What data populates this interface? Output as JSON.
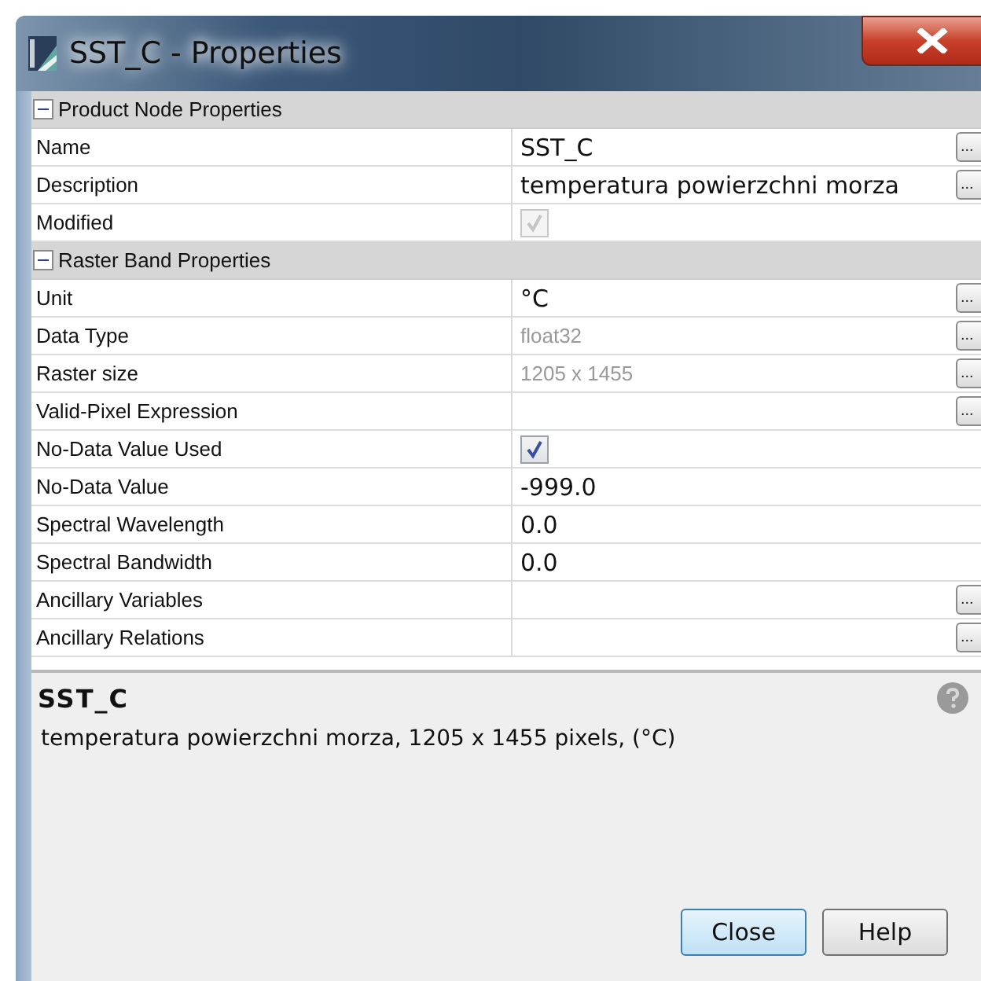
{
  "window": {
    "title": "SST_C - Properties"
  },
  "sections": [
    {
      "title": "Product Node Properties",
      "expanded": true,
      "rows": [
        {
          "label": "Name",
          "kind": "text",
          "value": "SST_C",
          "editable": true,
          "editor_button": "..."
        },
        {
          "label": "Description",
          "kind": "text",
          "value": "temperatura powierzchni morza",
          "editable": true,
          "editor_button": "..."
        },
        {
          "label": "Modified",
          "kind": "checkbox",
          "checked": true,
          "disabled": true
        }
      ]
    },
    {
      "title": "Raster Band Properties",
      "expanded": true,
      "rows": [
        {
          "label": "Unit",
          "kind": "text",
          "value": "°C",
          "editable": true,
          "editor_button": "..."
        },
        {
          "label": "Data Type",
          "kind": "text",
          "value": "float32",
          "editable": false,
          "editor_button": "..."
        },
        {
          "label": "Raster size",
          "kind": "text",
          "value": "1205 x 1455",
          "editable": false,
          "editor_button": "..."
        },
        {
          "label": "Valid-Pixel Expression",
          "kind": "text",
          "editor_button": "..."
        },
        {
          "label": "No-Data Value Used",
          "kind": "checkbox",
          "checked": true,
          "disabled": false
        },
        {
          "label": "No-Data Value",
          "kind": "text",
          "value": "-999.0",
          "editable": true
        },
        {
          "label": "Spectral Wavelength",
          "kind": "text",
          "value": "0.0",
          "editable": true
        },
        {
          "label": "Spectral Bandwidth",
          "kind": "text",
          "value": "0.0",
          "editable": true
        },
        {
          "label": "Ancillary Variables",
          "kind": "text",
          "editor_button": "..."
        },
        {
          "label": "Ancillary Relations",
          "kind": "text",
          "editor_button": "..."
        }
      ]
    }
  ],
  "description": {
    "title": "SST_C",
    "text": "temperatura powierzchni morza, 1205 x 1455 pixels, (°C)"
  },
  "buttons": [
    {
      "label": "Close",
      "default": true
    },
    {
      "label": "Help",
      "default": false
    }
  ]
}
